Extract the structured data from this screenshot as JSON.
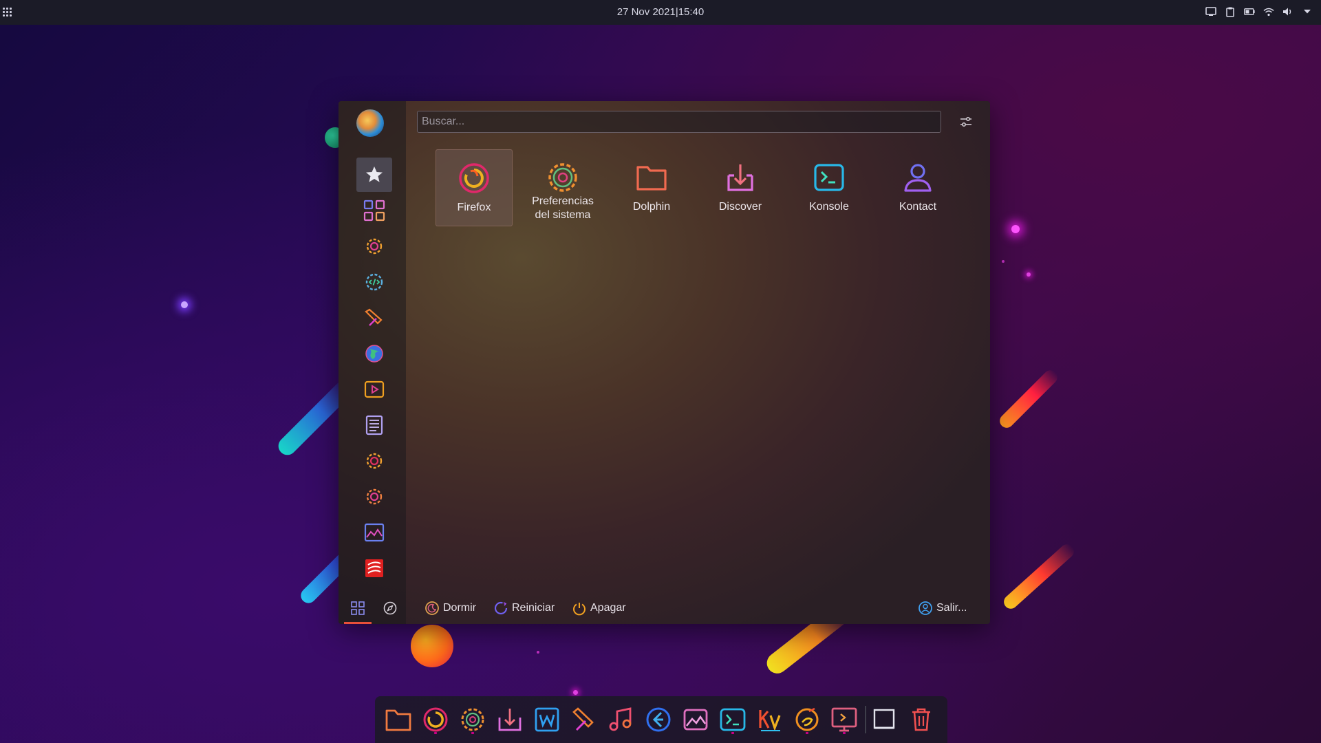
{
  "topbar": {
    "clock": "27 Nov 2021|15:40",
    "tray_icons": [
      "display-icon",
      "clipboard-icon",
      "battery-icon",
      "wifi-icon",
      "volume-icon",
      "chevron-down-icon"
    ]
  },
  "launcher": {
    "search_placeholder": "Buscar...",
    "categories": [
      {
        "name": "favorites-icon",
        "active": true
      },
      {
        "name": "all-apps-icon"
      },
      {
        "name": "settings-gear-icon"
      },
      {
        "name": "development-icon"
      },
      {
        "name": "graphics-icon"
      },
      {
        "name": "internet-globe-icon"
      },
      {
        "name": "multimedia-icon"
      },
      {
        "name": "office-icon"
      },
      {
        "name": "settings-icon"
      },
      {
        "name": "system-icon"
      },
      {
        "name": "utilities-icon"
      },
      {
        "name": "lost-found-icon"
      }
    ],
    "apps": [
      {
        "label": "Firefox",
        "icon": "firefox-icon",
        "selected": true
      },
      {
        "label": "Preferencias del sistema",
        "icon": "system-settings-icon"
      },
      {
        "label": "Dolphin",
        "icon": "folder-icon"
      },
      {
        "label": "Discover",
        "icon": "discover-icon"
      },
      {
        "label": "Konsole",
        "icon": "terminal-icon"
      },
      {
        "label": "Kontact",
        "icon": "contact-icon"
      }
    ],
    "power": {
      "sleep": "Dormir",
      "restart": "Reiniciar",
      "shutdown": "Apagar",
      "logout": "Salir..."
    }
  },
  "dock": {
    "icons": [
      "folder-icon",
      "firefox-icon",
      "settings-icon",
      "discover-icon",
      "writer-icon",
      "paint-icon",
      "music-icon",
      "vscode-icon",
      "image-viewer-icon",
      "terminal-icon",
      "kvantum-icon",
      "ktorrent-icon",
      "remote-desktop-icon",
      "show-desktop-icon",
      "trash-icon"
    ]
  },
  "colors": {
    "accent_underline": "#e8503a",
    "panel_bg": "#1b1b27"
  }
}
